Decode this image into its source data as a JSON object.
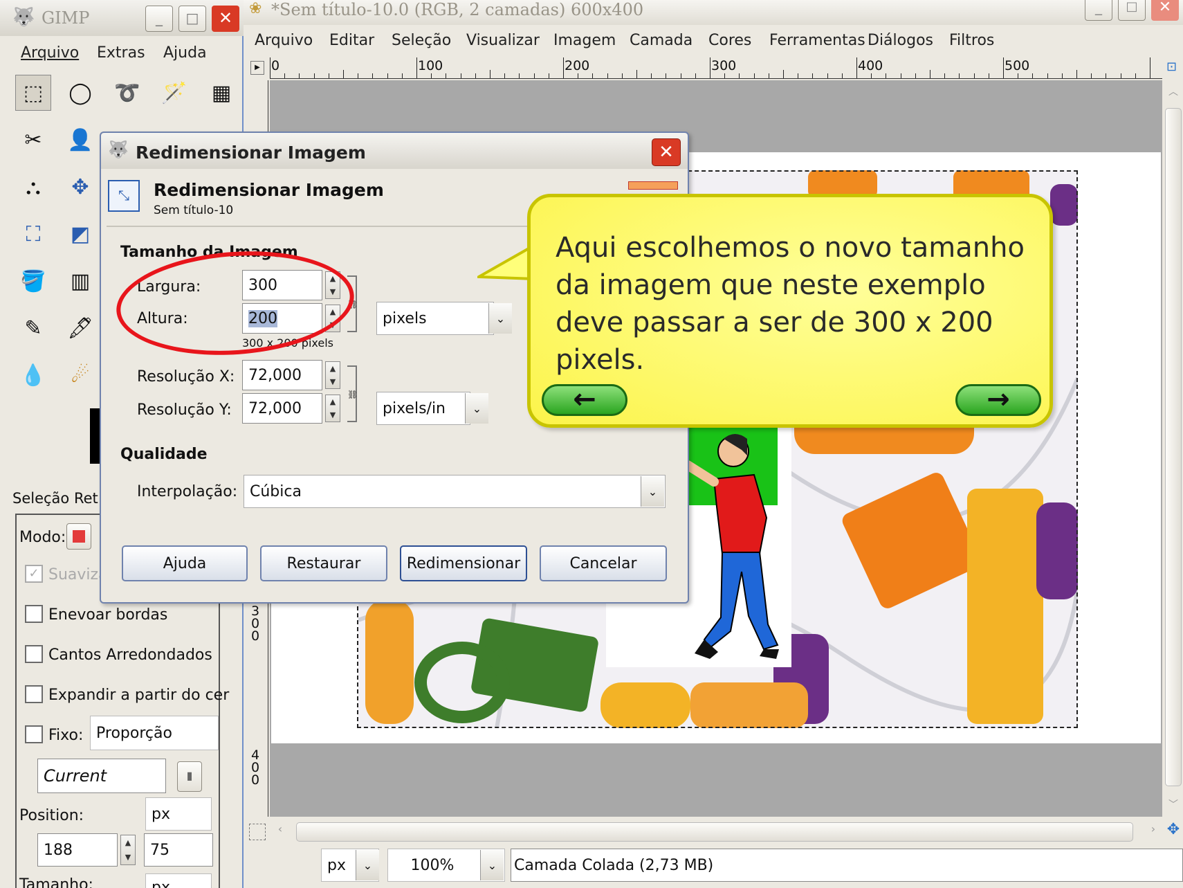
{
  "toolbox": {
    "title": "GIMP",
    "menu": [
      "Arquivo",
      "Extras",
      "Ajuda"
    ],
    "tool_options": {
      "title": "Seleção Ret.",
      "mode_label": "Modo:",
      "antialias": "Suaviza",
      "feather": "Enevoar bordas",
      "rounded": "Cantos Arredondados",
      "expand": "Expandir a partir do cer",
      "fixed": "Fixo:",
      "fixed_value": "Proporção",
      "current": "Current",
      "position_label": "Position:",
      "position_unit": "px",
      "pos_x": "188",
      "pos_y": "75",
      "size_label": "Tamanho:",
      "size_unit": "px"
    }
  },
  "image_window": {
    "title": "*Sem título-10.0 (RGB, 2 camadas) 600x400",
    "menu": [
      "Arquivo",
      "Editar",
      "Seleção",
      "Visualizar",
      "Imagem",
      "Camada",
      "Cores",
      "Ferramentas",
      "Diálogos",
      "Filtros"
    ],
    "ruler_labels": [
      "0",
      "100",
      "200",
      "300",
      "400",
      "500"
    ],
    "vruler_labels": [
      "300",
      "400"
    ],
    "status": {
      "unit": "px",
      "zoom": "100%",
      "layer": "Camada Colada (2,73 MB)"
    }
  },
  "dialog": {
    "title": "Redimensionar Imagem",
    "header_title": "Redimensionar Imagem",
    "header_subtitle": "Sem título-10",
    "section_size": "Tamanho da Imagem",
    "width_label": "Largura:",
    "width_value": "300",
    "height_label": "Altura:",
    "height_value": "200",
    "size_hint": "300 x 200 pixels",
    "unit": "pixels",
    "res_x_label": "Resolução X:",
    "res_x_value": "72,000",
    "res_y_label": "Resolução Y:",
    "res_y_value": "72,000",
    "res_unit": "pixels/in",
    "section_quality": "Qualidade",
    "interp_label": "Interpolação:",
    "interp_value": "Cúbica",
    "buttons": {
      "help": "Ajuda",
      "reset": "Restaurar",
      "resize": "Redimensionar",
      "cancel": "Cancelar"
    }
  },
  "callout": {
    "text": "Aqui escolhemos o novo tamanho da imagem que neste exemplo deve passar a ser de 300 x 200 pixels.",
    "prev": "←",
    "next": "→"
  },
  "colors": {
    "highlight_circle": "#e8151b",
    "callout_bg": "#ffff7a",
    "callout_border": "#c8c400",
    "nav_button": "#3fbf2f"
  }
}
